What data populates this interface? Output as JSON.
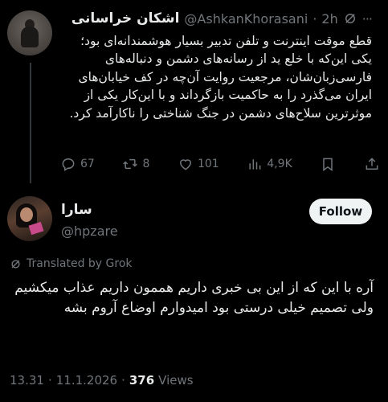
{
  "parent_tweet": {
    "author_name": "اشکان خراسانی",
    "handle": "@AshkanKhorasani",
    "time": "2h",
    "more": "···",
    "text": "قطع موقت اینترنت و تلفن تدبیر بسیار هوشمندانه‌ای بود؛ یکی این‌که با خلع ید از رسانه‌های دشمن و دنباله‌های فارسی‌زبان‌شان، مرجعیت روایت آن‌چه در کف خیابان‌های ایران می‌گذرد را به حاکمیت بازگرداند و با این‌کار یکی از موثرترین سلاح‌های دشمن در جنگ شناختی را ناکارآمد کرد.",
    "actions": {
      "replies": "67",
      "reposts": "8",
      "likes": "101",
      "views": "4,9K"
    }
  },
  "reply": {
    "author_name": "سارا",
    "handle": "@hpzare",
    "follow_label": "Follow",
    "translated_label": "Translated by Grok",
    "text": "آره با این که از این بی خبری داریم هممون داریم عذاب میکشیم ولی تصمیم خیلی درستی بود امیدوارم اوضاع آروم بشه",
    "time": "13.31",
    "date": "11.1.2026",
    "separator": "·",
    "views_count": "376",
    "views_label": "Views"
  },
  "colors": {
    "background": "#000000",
    "text": "#e7e9ea",
    "muted": "#71767b",
    "follow_bg": "#eff3f4"
  }
}
